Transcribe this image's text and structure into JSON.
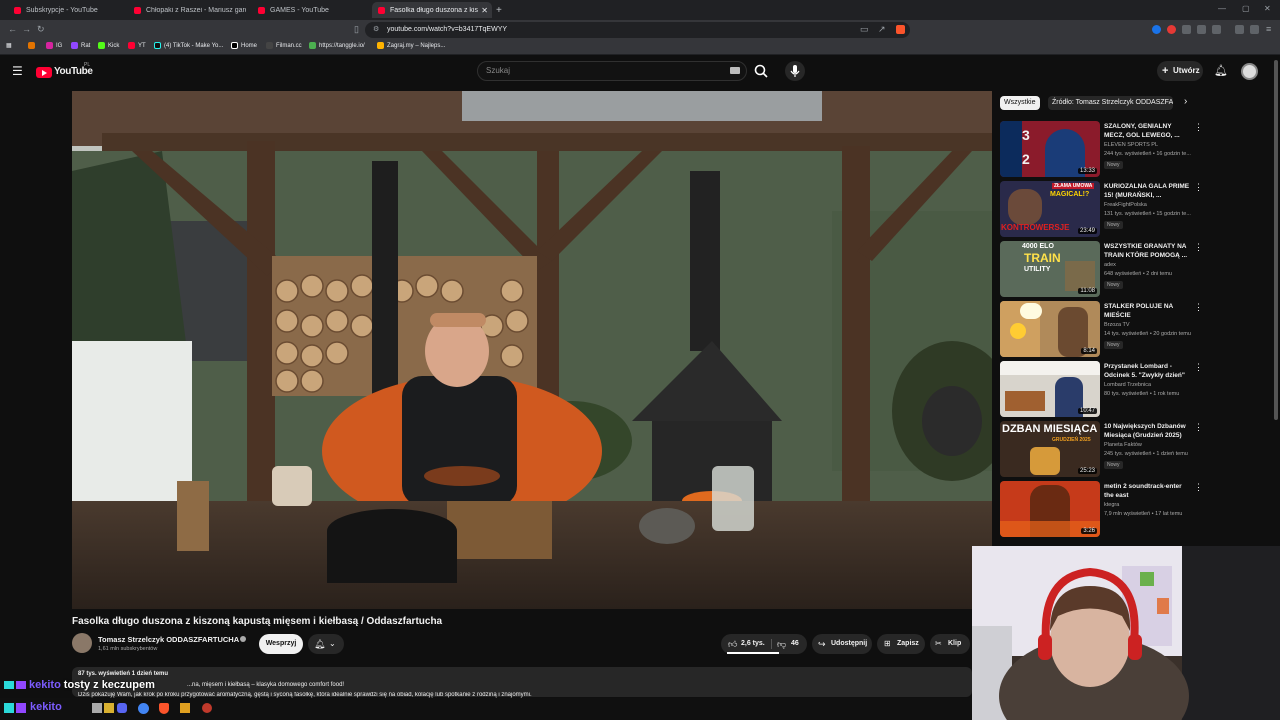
{
  "browser": {
    "tabs": [
      {
        "label": "Subskrypcje - YouTube"
      },
      {
        "label": "Chłopaki z Raszei - Mariusz gardzi p"
      },
      {
        "label": "GAMES - YouTube"
      },
      {
        "label": "Fasolka długo duszona z kisz"
      }
    ],
    "url": "youtube.com/watch?v=b3417TqEWYY",
    "bookmarks": [
      "IG",
      "Rat",
      "Kick",
      "YT",
      "(4) TikTok - Make Yo...",
      "Home",
      "Filman.cc",
      "https://tanggle.io/",
      "Zagraj.my – Najleps..."
    ]
  },
  "youtube": {
    "logo_text": "YouTube",
    "logo_region": "PL",
    "search_placeholder": "Szukaj",
    "create_label": "Utwórz"
  },
  "video": {
    "title": "Fasolka długo duszona z kiszoną kapustą mięsem i kiełbasą / Oddaszfartucha",
    "channel": "Tomasz Strzelczyk ODDASZFARTUCHA",
    "subscribers": "1,61 mln subskrybentów",
    "support_label": "Wesprzyj",
    "likes": "2,6 tys.",
    "dislikes": "46",
    "share_label": "Udostępnij",
    "save_label": "Zapisz",
    "clip_label": "Klip",
    "views_date": "87 tys. wyświetleń  1 dzień temu",
    "desc_line1": "...na, mięsem i kiełbasą – klasyka domowego comfort food!",
    "desc_line2": "Dziś pokazuję Wam, jak krok po kroku przygotować aromatyczną, gęstą i syconą fasolkę, która idealnie sprawdzi się na obiad, kolację lub spotkanie z rodziną i znajomymi."
  },
  "chips": {
    "all": "Wszystkie",
    "source": "Źródło: Tomasz Strzelczyk ODDASZFA"
  },
  "recommendations": [
    {
      "title": "SZALONY, GENIALNY MECZ, GOL LEWEGO, ...",
      "channel": "ELEVEN SPORTS PL",
      "meta": "244 tys. wyświetleń • 16 godzin te...",
      "badge": "Nowy",
      "duration": "13:33"
    },
    {
      "title": "KURIOZALNA GALA PRIME 15! (MURAŃSKI, ...",
      "channel": "FreakFightPolska",
      "meta": "131 tys. wyświetleń • 15 godzin te...",
      "badge": "Nowy",
      "duration": "23:49"
    },
    {
      "title": "WSZYSTKIE GRANATY NA TRAIN KTÓRE POMOGĄ ...",
      "channel": "adex",
      "meta": "648 wyświetleń • 2 dni temu",
      "badge": "Nowy",
      "duration": "11:08"
    },
    {
      "title": "STALKER POLUJE NA MIEŚCIE",
      "channel": "Brzoza TV",
      "meta": "14 tys. wyświetleń • 20 godzin temu",
      "badge": "Nowy",
      "duration": "8:14"
    },
    {
      "title": "Przystanek Lombard - Odcinek 5. \"Zwykły dzień\"",
      "channel": "Lombard Trzebnica",
      "meta": "80 tys. wyświetleń • 1 rok temu",
      "badge": "",
      "duration": "10:47"
    },
    {
      "title": "10 Największych Dzbanów Miesiąca (Grudzień 2025)",
      "channel": "Planeta Faktów",
      "meta": "245 tys. wyświetleń • 1 dzień temu",
      "badge": "Nowy",
      "duration": "25:23"
    },
    {
      "title": "metin 2 soundtrack-enter the east",
      "channel": "ktegra",
      "meta": "7,9 mln wyświetleń • 17 lat temu",
      "badge": "",
      "duration": "3:26"
    }
  ],
  "thumb_text": {
    "score_a": "3",
    "score_b": "2",
    "gala_a": "ZŁAMA UMOWA",
    "gala_b": "MAGICAL!?",
    "gala_c": "KONTROWERSJE",
    "elo": "4000 ELO",
    "train": "TRAIN",
    "utility": "UTILITY",
    "dzban": "DZBAN MIESIĄCA",
    "dzban_date": "GRUDZIEŃ 2025"
  },
  "overlay": {
    "chat_name": "kekito",
    "chat_msg": "tosty z keczupem",
    "chat_name2": "kekito"
  },
  "colors": {
    "yt_red": "#ff0033",
    "bg": "#0f0f0f",
    "chip_active": "#f1f1f1"
  }
}
